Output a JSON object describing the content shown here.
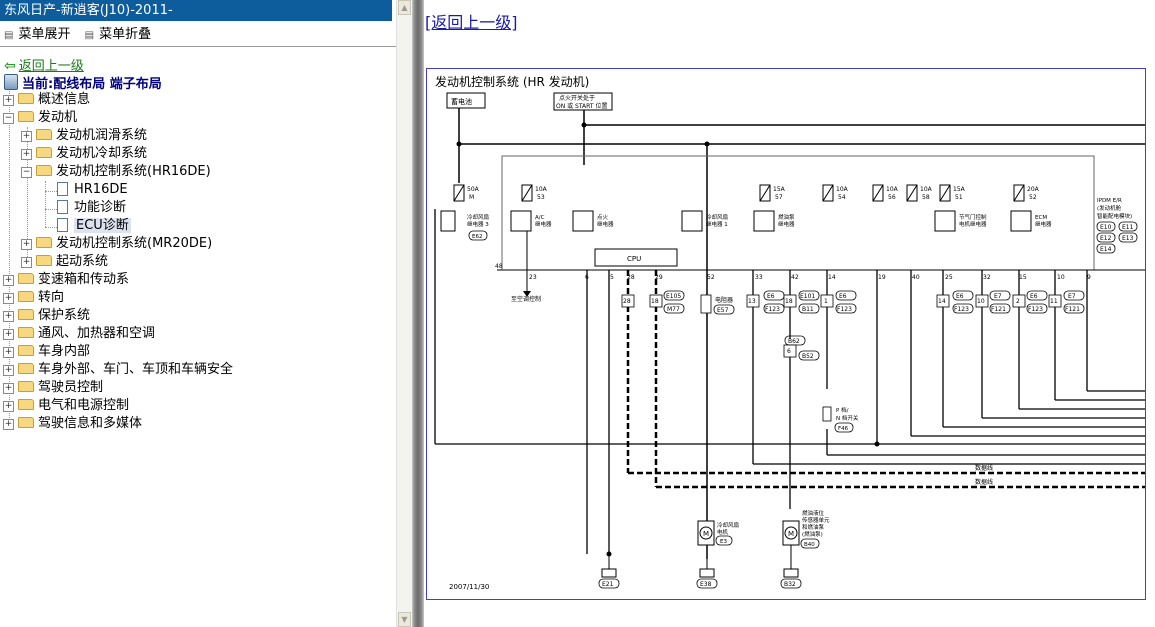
{
  "window": {
    "title": "东风日产-新逍客(J10)-2011-"
  },
  "menu": {
    "expand_label": "菜单展开",
    "collapse_label": "菜单折叠"
  },
  "nav": {
    "back_label": "返回上一级",
    "current_label": "当前:配线布局 端子布局"
  },
  "tree": {
    "items": [
      {
        "label": "概述信息",
        "toggle": "+"
      },
      {
        "label": "发动机",
        "toggle": "−"
      },
      {
        "label": "发动机润滑系统",
        "toggle": "+"
      },
      {
        "label": "发动机冷却系统",
        "toggle": "+"
      },
      {
        "label": "发动机控制系统(HR16DE)",
        "toggle": "−"
      },
      {
        "label": "HR16DE"
      },
      {
        "label": "功能诊断"
      },
      {
        "label": "ECU诊断",
        "selected": true
      },
      {
        "label": "发动机控制系统(MR20DE)",
        "toggle": "+"
      },
      {
        "label": "起动系统",
        "toggle": "+"
      },
      {
        "label": "变速箱和传动系",
        "toggle": "+"
      },
      {
        "label": "转向",
        "toggle": "+"
      },
      {
        "label": "保护系统",
        "toggle": "+"
      },
      {
        "label": "通风、加热器和空调",
        "toggle": "+"
      },
      {
        "label": "车身内部",
        "toggle": "+"
      },
      {
        "label": "车身外部、车门、车顶和车辆安全",
        "toggle": "+"
      },
      {
        "label": "驾驶员控制",
        "toggle": "+"
      },
      {
        "label": "电气和电源控制",
        "toggle": "+"
      },
      {
        "label": "驾驶信息和多媒体",
        "toggle": "+"
      }
    ]
  },
  "content": {
    "back_label": "[返回上一级]"
  },
  "diagram": {
    "title": "发动机控制系统 (HR 发动机)",
    "battery": "蓄电池",
    "ignition_note_line1": "点火开关处于",
    "ignition_note_line2": "ON 或 START 位置",
    "ipdm_line1": "IPDM E/R",
    "ipdm_line2": "(发动机舱",
    "ipdm_line3": "智能配电模块)",
    "ipdm_connectors": [
      "E10",
      "E11",
      "E12",
      "E13",
      "E14"
    ],
    "cpu": "CPU",
    "fuses": [
      {
        "rating": "50A",
        "id": "M"
      },
      {
        "rating": "10A",
        "id": "53"
      },
      {
        "rating": "15A",
        "id": "57"
      },
      {
        "rating": "10A",
        "id": "54"
      },
      {
        "rating": "10A",
        "id": "56"
      },
      {
        "rating": "10A",
        "id": "58"
      },
      {
        "rating": "15A",
        "id": "51"
      },
      {
        "rating": "20A",
        "id": "52"
      }
    ],
    "relays": [
      {
        "line1": "冷却风扇",
        "line2": "继电器 3",
        "conn": "E62"
      },
      {
        "line1": "A/C",
        "line2": "继电器"
      },
      {
        "line1": "点火",
        "line2": "继电器"
      },
      {
        "line1": "冷却风扇",
        "line2": "继电器 1"
      },
      {
        "line1": "燃油泵",
        "line2": "继电器"
      },
      {
        "line1": "节气门控制",
        "line2": "电机继电器"
      },
      {
        "line1": "ECM",
        "line2": "继电器"
      }
    ],
    "terminals": [
      "48",
      "23",
      "6",
      "5",
      "28",
      "29",
      "52",
      "33",
      "42",
      "14",
      "19",
      "40",
      "25",
      "32",
      "15",
      "10",
      "9"
    ],
    "ac_control": "至空调控制",
    "connectors": [
      {
        "pins": "28",
        "id": "E105"
      },
      {
        "pins": "18",
        "id": "M77"
      },
      {
        "pins": "",
        "id": "E57"
      },
      {
        "pins": "13",
        "id": "E6"
      },
      {
        "pins": "",
        "id": "F123"
      },
      {
        "pins": "18",
        "id": "E101"
      },
      {
        "pins": "",
        "id": "B11"
      },
      {
        "pins": "",
        "id": "B62"
      },
      {
        "pins": "6",
        "id": "B52"
      },
      {
        "pins": "1",
        "id": "E6"
      },
      {
        "pins": "",
        "id": "F123"
      },
      {
        "pins": "14",
        "id": "E6"
      },
      {
        "pins": "",
        "id": "F123"
      },
      {
        "pins": "10",
        "id": "E7"
      },
      {
        "pins": "",
        "id": "F121"
      },
      {
        "pins": "2",
        "id": "E6"
      },
      {
        "pins": "",
        "id": "F123"
      },
      {
        "pins": "11",
        "id": "E7"
      },
      {
        "pins": "",
        "id": "F121"
      }
    ],
    "resistor_label": "电阻器",
    "pn_switch_line1": "P 档/",
    "pn_switch_line2": "N 档开关",
    "pn_switch_conn": "F46",
    "data_line": "数据线",
    "fan_motor_line1": "冷却风扇",
    "fan_motor_line2": "电机",
    "fan_motor_conn": "E3",
    "fuel_line1": "燃油液位",
    "fuel_line2": "传感器单元",
    "fuel_line3": "和燃油泵",
    "fuel_line4": "(燃油泵)",
    "fuel_conn": "B40",
    "grounds": [
      "E21",
      "E38",
      "B32"
    ],
    "date": "2007/11/30"
  }
}
